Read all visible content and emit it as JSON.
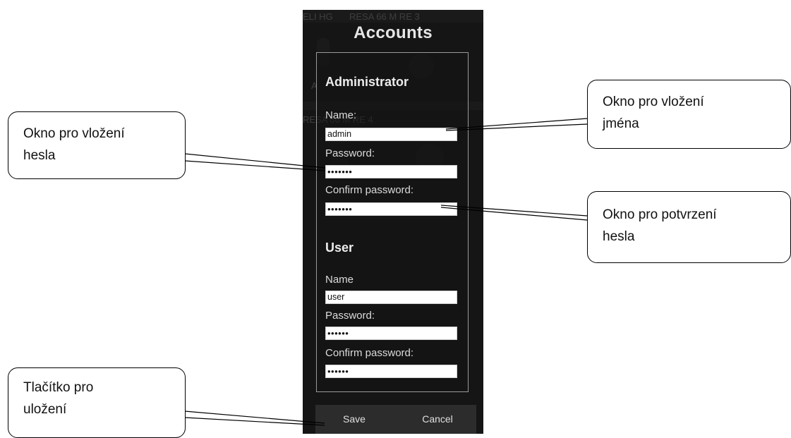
{
  "dialog": {
    "title": "Accounts",
    "background_labels": [
      "ELI HG",
      "RESA 66 M RE 3",
      "RESA 66 M RE 4",
      "A"
    ],
    "administrator": {
      "heading": "Administrator",
      "name_label": "Name:",
      "name_value": "admin",
      "password_label": "Password:",
      "password_value": "•••••••",
      "confirm_label": "Confirm password:",
      "confirm_value": "•••••••"
    },
    "user": {
      "heading": "User",
      "name_label": "Name",
      "name_value": "user",
      "password_label": "Password:",
      "password_value": "••••••",
      "confirm_label": "Confirm password:",
      "confirm_value": "••••••"
    },
    "buttons": {
      "save": "Save",
      "cancel": "Cancel"
    }
  },
  "callouts": {
    "password_box": [
      "Okno pro vložení",
      "hesla"
    ],
    "name_box": [
      "Okno pro vložení",
      "jména"
    ],
    "confirm_box": [
      "Okno pro potvrzení",
      "hesla"
    ],
    "save_button": [
      "Tlačítko pro",
      "uložení"
    ]
  },
  "colors": {
    "panel": "#151515",
    "text": "#dcdcdc",
    "callout_border": "#000000"
  }
}
